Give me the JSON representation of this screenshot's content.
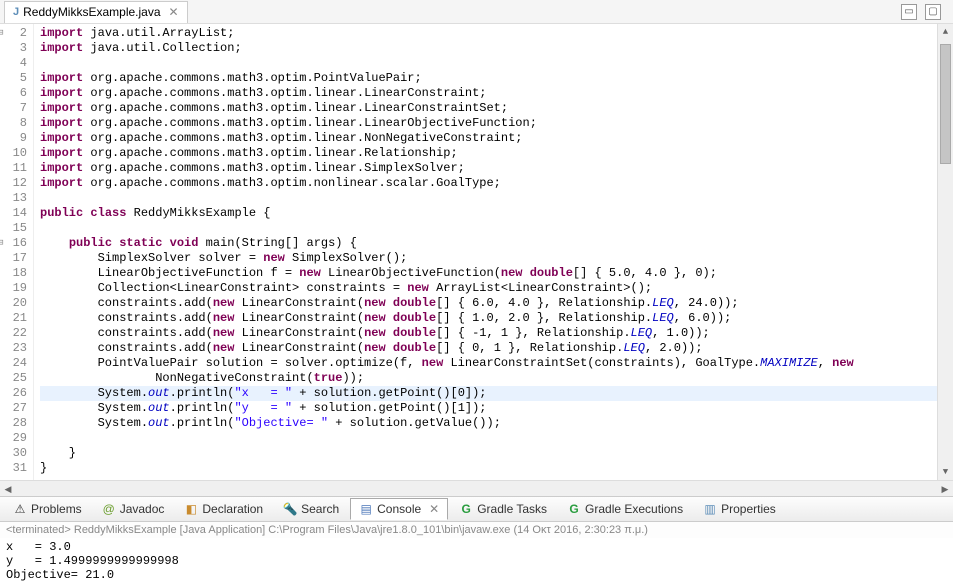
{
  "editor": {
    "tab_label": "ReddyMikksExample.java",
    "lines": [
      {
        "n": 2,
        "fold": "minus",
        "html": "<span class='kw'>import</span> java.util.ArrayList;"
      },
      {
        "n": 3,
        "html": "<span class='kw'>import</span> java.util.Collection;"
      },
      {
        "n": 4,
        "html": ""
      },
      {
        "n": 5,
        "html": "<span class='kw'>import</span> org.apache.commons.math3.optim.PointValuePair;"
      },
      {
        "n": 6,
        "html": "<span class='kw'>import</span> org.apache.commons.math3.optim.linear.LinearConstraint;"
      },
      {
        "n": 7,
        "html": "<span class='kw'>import</span> org.apache.commons.math3.optim.linear.LinearConstraintSet;"
      },
      {
        "n": 8,
        "html": "<span class='kw'>import</span> org.apache.commons.math3.optim.linear.LinearObjectiveFunction;"
      },
      {
        "n": 9,
        "html": "<span class='kw'>import</span> org.apache.commons.math3.optim.linear.NonNegativeConstraint;"
      },
      {
        "n": 10,
        "html": "<span class='kw'>import</span> org.apache.commons.math3.optim.linear.Relationship;"
      },
      {
        "n": 11,
        "html": "<span class='kw'>import</span> org.apache.commons.math3.optim.linear.SimplexSolver;"
      },
      {
        "n": 12,
        "html": "<span class='kw'>import</span> org.apache.commons.math3.optim.nonlinear.scalar.GoalType;"
      },
      {
        "n": 13,
        "html": ""
      },
      {
        "n": 14,
        "html": "<span class='kw'>public</span> <span class='kw'>class</span> ReddyMikksExample {"
      },
      {
        "n": 15,
        "html": ""
      },
      {
        "n": 16,
        "fold": "minus",
        "html": "    <span class='kw'>public</span> <span class='kw'>static</span> <span class='kw'>void</span> main(String[] args) {"
      },
      {
        "n": 17,
        "html": "        SimplexSolver solver = <span class='kw'>new</span> SimplexSolver();"
      },
      {
        "n": 18,
        "html": "        LinearObjectiveFunction f = <span class='kw'>new</span> LinearObjectiveFunction(<span class='kw'>new</span> <span class='kw'>double</span>[] { 5.0, 4.0 }, 0);"
      },
      {
        "n": 19,
        "html": "        Collection&lt;LinearConstraint&gt; constraints = <span class='kw'>new</span> ArrayList&lt;LinearConstraint&gt;();"
      },
      {
        "n": 20,
        "html": "        constraints.add(<span class='kw'>new</span> LinearConstraint(<span class='kw'>new</span> <span class='kw'>double</span>[] { 6.0, 4.0 }, Relationship.<span class='enum'>LEQ</span>, 24.0));"
      },
      {
        "n": 21,
        "html": "        constraints.add(<span class='kw'>new</span> LinearConstraint(<span class='kw'>new</span> <span class='kw'>double</span>[] { 1.0, 2.0 }, Relationship.<span class='enum'>LEQ</span>, 6.0));"
      },
      {
        "n": 22,
        "html": "        constraints.add(<span class='kw'>new</span> LinearConstraint(<span class='kw'>new</span> <span class='kw'>double</span>[] { -1, 1 }, Relationship.<span class='enum'>LEQ</span>, 1.0));"
      },
      {
        "n": 23,
        "html": "        constraints.add(<span class='kw'>new</span> LinearConstraint(<span class='kw'>new</span> <span class='kw'>double</span>[] { 0, 1 }, Relationship.<span class='enum'>LEQ</span>, 2.0));"
      },
      {
        "n": 24,
        "html": "        PointValuePair solution = solver.optimize(f, <span class='kw'>new</span> LinearConstraintSet(constraints), GoalType.<span class='enum'>MAXIMIZE</span>, <span class='kw'>new</span>"
      },
      {
        "n": 25,
        "html": "                NonNegativeConstraint(<span class='kw'>true</span>));"
      },
      {
        "n": 26,
        "hl": true,
        "html": "        System.<span class='field'>out</span>.println(<span class='str'>\"x   = \"</span> + solution.getPoint()[0]);"
      },
      {
        "n": 27,
        "html": "        System.<span class='field'>out</span>.println(<span class='str'>\"y   = \"</span> + solution.getPoint()[1]);"
      },
      {
        "n": 28,
        "html": "        System.<span class='field'>out</span>.println(<span class='str'>\"Objective= \"</span> + solution.getValue());"
      },
      {
        "n": 29,
        "html": ""
      },
      {
        "n": 30,
        "html": "    }"
      },
      {
        "n": 31,
        "html": "}"
      }
    ]
  },
  "views": {
    "problems": "Problems",
    "javadoc": "Javadoc",
    "declaration": "Declaration",
    "search": "Search",
    "console": "Console",
    "gradle_tasks": "Gradle Tasks",
    "gradle_exec": "Gradle Executions",
    "properties": "Properties"
  },
  "console": {
    "header": "<terminated> ReddyMikksExample [Java Application] C:\\Program Files\\Java\\jre1.8.0_101\\bin\\javaw.exe (14 Οκτ 2016, 2:30:23 π.μ.)",
    "lines": [
      "x   = 3.0",
      "y   = 1.4999999999999998",
      "Objective= 21.0"
    ]
  }
}
